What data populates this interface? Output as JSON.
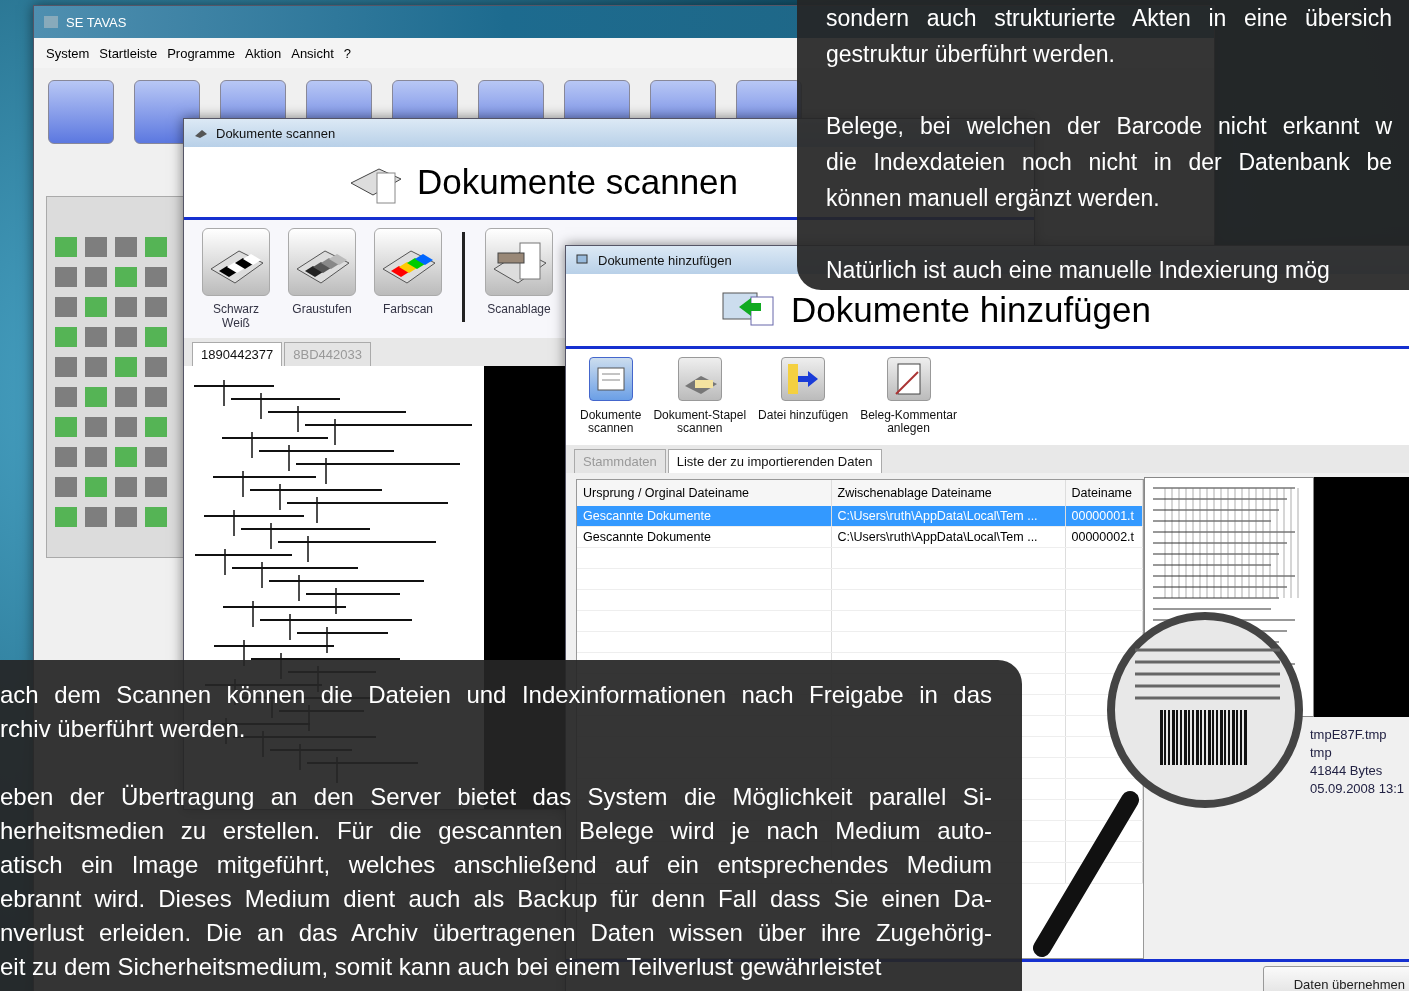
{
  "main_window": {
    "title": "SE TAVAS",
    "menu": [
      "System",
      "Startleiste",
      "Programme",
      "Aktion",
      "Ansicht",
      "?"
    ]
  },
  "scan_window": {
    "title": "Dokumente scannen",
    "heading": "Dokumente scannen",
    "tools": [
      {
        "label": "Schwarz Weiß",
        "kind": "bw"
      },
      {
        "label": "Graustufen",
        "kind": "gray"
      },
      {
        "label": "Farbscan",
        "kind": "color"
      },
      {
        "label": "Scanablage",
        "kind": "tray"
      }
    ],
    "tabs": [
      {
        "label": "1890442377",
        "selected": true
      },
      {
        "label": "8BD442033",
        "selected": false
      }
    ]
  },
  "add_window": {
    "title": "Dokumente hinzufügen",
    "heading": "Dokumente hinzufügen",
    "tools": [
      {
        "label": "Dokumente\nscannen",
        "kind": "scan",
        "selected": true
      },
      {
        "label": "Dokument-Stapel\nscannen",
        "kind": "stack",
        "selected": false
      },
      {
        "label": "Datei hinzufügen",
        "kind": "file",
        "selected": false
      },
      {
        "label": "Beleg-Kommentar\nanlegen",
        "kind": "comment",
        "selected": false
      }
    ],
    "tabs": [
      {
        "label": "Stammdaten",
        "selected": false
      },
      {
        "label": "Liste der zu importierenden Daten",
        "selected": true
      }
    ],
    "table": {
      "columns": [
        "Ursprung / Orginal Dateiname",
        "Zwischenablage Dateiname",
        "Dateiname"
      ],
      "rows": [
        {
          "cells": [
            "Gescannte Dokumente",
            "C:\\Users\\ruth\\AppData\\Local\\Tem ...",
            "00000001.t"
          ],
          "selected": true
        },
        {
          "cells": [
            "Gescannte Dokumente",
            "C:\\Users\\ruth\\AppData\\Local\\Tem ...",
            "00000002.t"
          ],
          "selected": false
        }
      ]
    },
    "properties": [
      "tmpE87F.tmp",
      "tmp",
      "41844 Bytes",
      "05.09.2008 13:1"
    ],
    "primary_button": "Daten übernehmen"
  },
  "top_note": {
    "paragraphs": [
      [
        "sondern auch strukturierte Akten in eine übersich",
        "gestruktur überführt werden."
      ],
      [
        "Belege, bei welchen der Barcode nicht erkannt w",
        "die Indexdateien noch nicht in der Datenbank be",
        "können manuell ergänzt werden."
      ],
      [
        "Natürlich ist auch eine manuelle Indexierung mög"
      ]
    ]
  },
  "bottom_note": {
    "paragraphs": [
      [
        "ach dem Scannen können die Dateien und Indexinformationen nach Freigabe in das",
        "rchiv überführt werden."
      ],
      [
        "eben der Übertragung an den Server bietet das System die Möglichkeit parallel Si-",
        "herheitsmedien zu erstellen. Für die gescannten Belege wird je nach Medium auto-",
        "atisch ein Image mitgeführt, welches anschließend auf ein entsprechendes Medium",
        "ebrannt wird. Dieses Medium dient auch als Backup für denn Fall dass Sie einen Da-",
        "nverlust erleiden. Die an das Archiv übertragenen Daten wissen über ihre Zugehörig-",
        "eit zu dem Sicherheitsmedium, somit kann auch bei einem Teilverlust gewährleistet"
      ]
    ]
  }
}
